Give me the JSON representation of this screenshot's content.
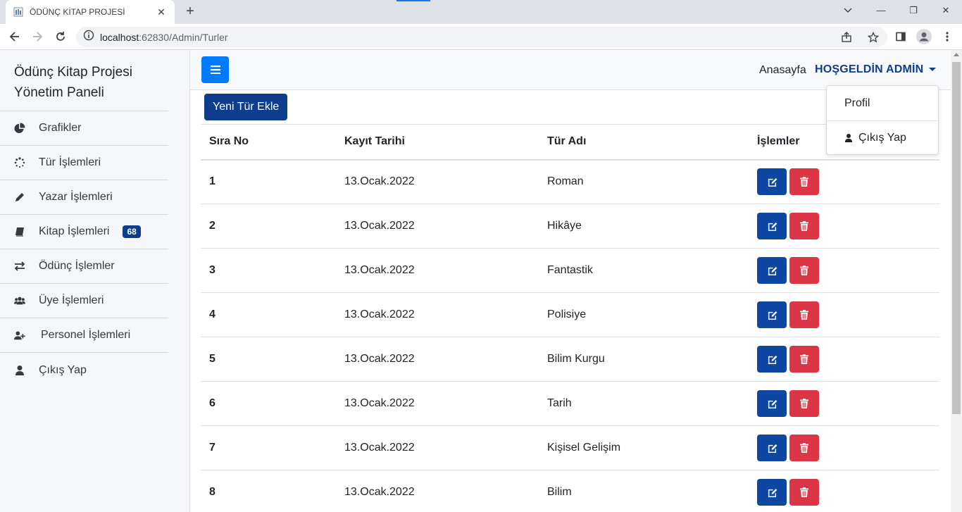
{
  "browser": {
    "tab_title": "ÖDÜNÇ KİTAP PROJESİ",
    "tab_close": "✕",
    "new_tab": "+",
    "url_host": "localhost",
    "url_rest": ":62830/Admin/Turler",
    "win_minimize": "—",
    "win_restore": "❐",
    "win_close": "✕"
  },
  "sidebar": {
    "brand_line1": "Ödünç Kitap Projesi",
    "brand_line2": "Yönetim Paneli",
    "items": [
      {
        "label": "Grafikler",
        "icon": "pie-chart-icon"
      },
      {
        "label": "Tür İşlemleri",
        "icon": "spinner-icon"
      },
      {
        "label": "Yazar İşlemleri",
        "icon": "pencil-icon"
      },
      {
        "label": "Kitap İşlemleri",
        "icon": "book-icon",
        "badge": "68"
      },
      {
        "label": "Ödünç İşlemler",
        "icon": "exchange-icon"
      },
      {
        "label": "Üye İşlemleri",
        "icon": "users-icon"
      },
      {
        "label": "Personel İşlemleri",
        "icon": "user-plus-icon"
      },
      {
        "label": "Çıkış Yap",
        "icon": "user-icon"
      }
    ]
  },
  "topbar": {
    "home": "Anasayfa",
    "admin": "HOŞGELDİN ADMİN"
  },
  "dropdown": {
    "profile": "Profil",
    "logout": "Çıkış Yap"
  },
  "add_button": "Yeni Tür Ekle",
  "table": {
    "headers": [
      "Sıra No",
      "Kayıt Tarihi",
      "Tür Adı",
      "İşlemler"
    ],
    "rows": [
      {
        "no": "1",
        "date": "13.Ocak.2022",
        "name": "Roman"
      },
      {
        "no": "2",
        "date": "13.Ocak.2022",
        "name": "Hikâye"
      },
      {
        "no": "3",
        "date": "13.Ocak.2022",
        "name": "Fantastik"
      },
      {
        "no": "4",
        "date": "13.Ocak.2022",
        "name": "Polisiye"
      },
      {
        "no": "5",
        "date": "13.Ocak.2022",
        "name": "Bilim Kurgu"
      },
      {
        "no": "6",
        "date": "13.Ocak.2022",
        "name": "Tarih"
      },
      {
        "no": "7",
        "date": "13.Ocak.2022",
        "name": "Kişisel Gelişim"
      },
      {
        "no": "8",
        "date": "13.Ocak.2022",
        "name": "Bilim"
      }
    ]
  },
  "colors": {
    "primary": "#007bff",
    "navy": "#0d3d8c",
    "edit": "#0d47a1",
    "danger": "#dc3545"
  }
}
